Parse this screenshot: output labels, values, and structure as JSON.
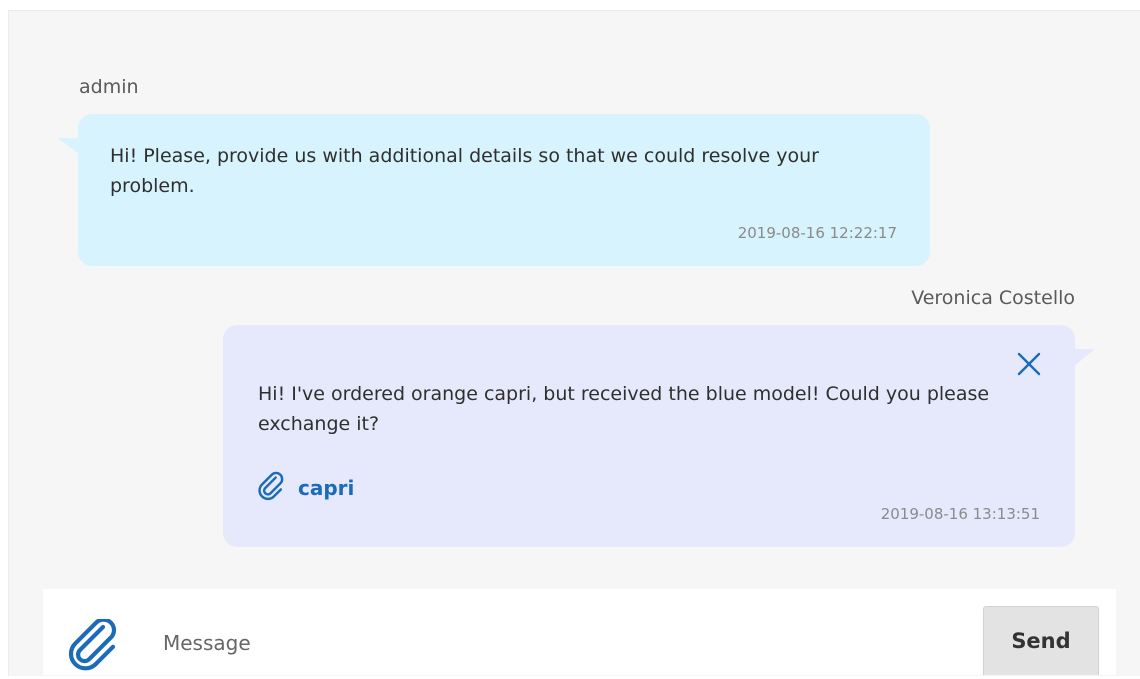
{
  "messages": [
    {
      "sender": "admin",
      "text": "Hi! Please, provide us with additional details so that we could resolve your problem.",
      "timestamp": "2019-08-16 12:22:17"
    },
    {
      "sender": "Veronica Costello",
      "text": "Hi! I've ordered orange capri, but received the blue model! Could you please exchange it?",
      "attachment": {
        "name": "capri",
        "icon": "paperclip-icon"
      },
      "timestamp": "2019-08-16 13:13:51",
      "close_icon": "close-icon"
    }
  ],
  "composer": {
    "placeholder": "Message",
    "value": "",
    "attach_icon": "paperclip-icon",
    "send_label": "Send"
  },
  "colors": {
    "admin_bubble": "#d7f3fd",
    "user_bubble": "#e6e9fc",
    "link": "#1b6bb8",
    "panel_bg": "#f6f6f6"
  }
}
